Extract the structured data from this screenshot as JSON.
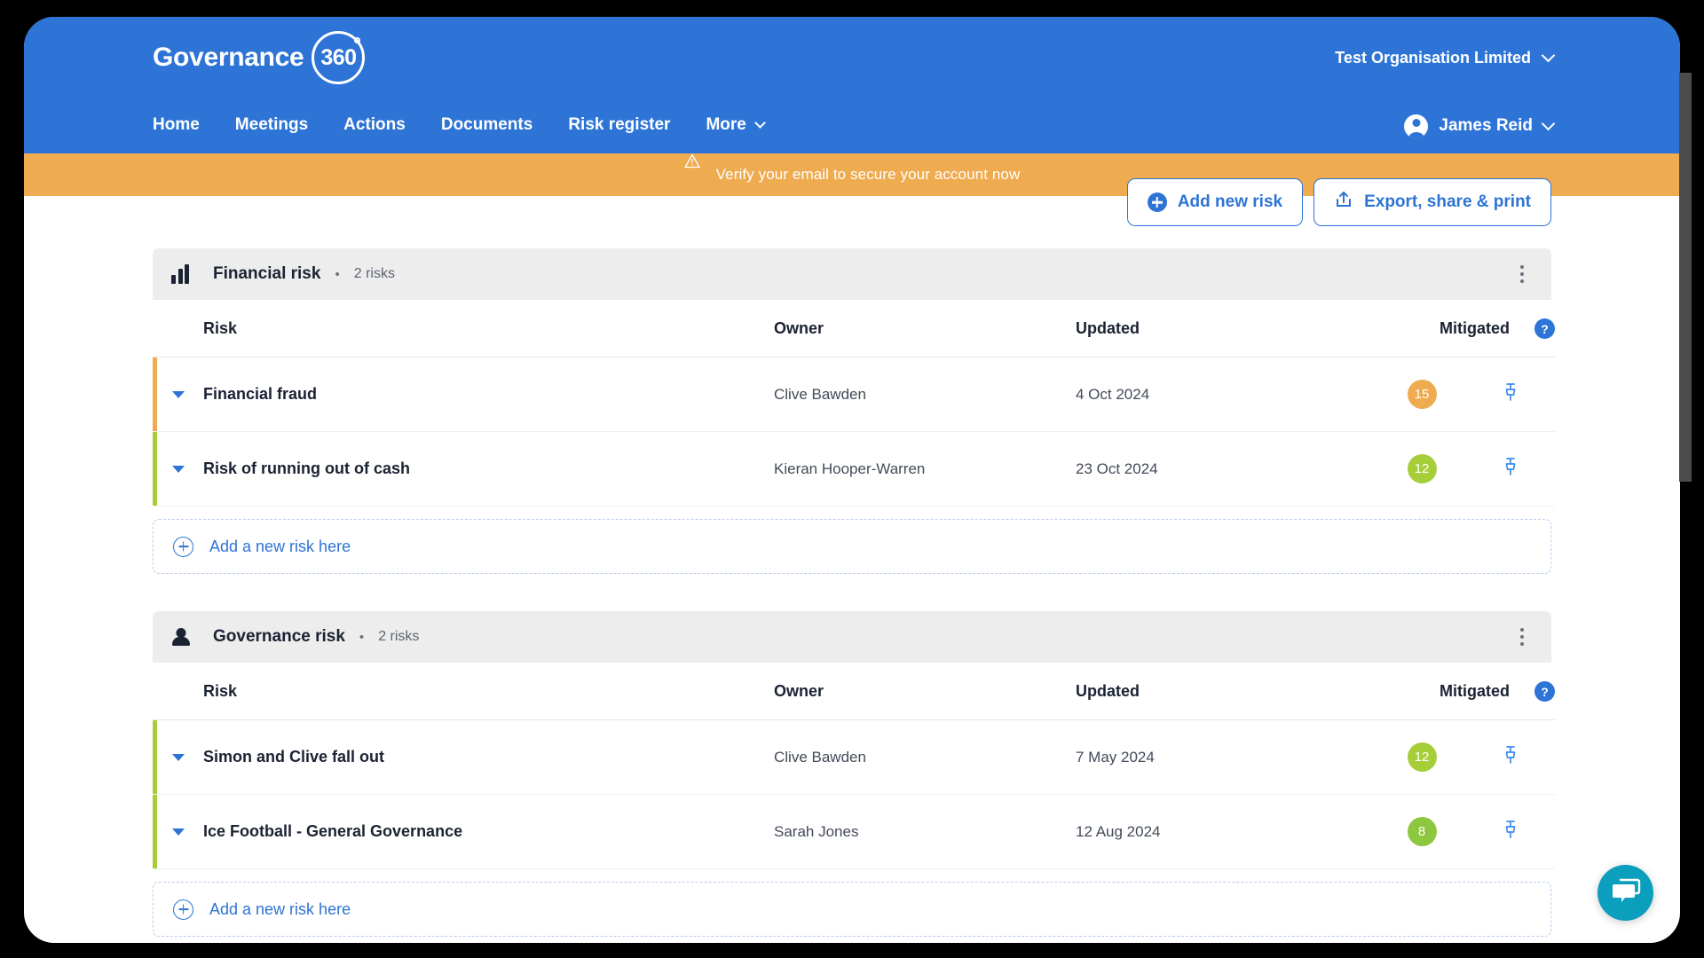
{
  "header": {
    "logo_word": "Governance",
    "logo_badge": "360",
    "org_name": "Test Organisation Limited",
    "user_name": "James Reid",
    "nav": [
      {
        "label": "Home",
        "has_chevron": false
      },
      {
        "label": "Meetings",
        "has_chevron": false
      },
      {
        "label": "Actions",
        "has_chevron": false
      },
      {
        "label": "Documents",
        "has_chevron": false
      },
      {
        "label": "Risk register",
        "has_chevron": false
      },
      {
        "label": "More",
        "has_chevron": true
      }
    ]
  },
  "banner": {
    "message": "Verify your email to secure your account now",
    "bg_color": "#eeab4f"
  },
  "toolbar": {
    "add_new_risk_label": "Add new risk",
    "export_label": "Export, share & print",
    "accent_color": "#2d74d6"
  },
  "table_headers": {
    "risk": "Risk",
    "owner": "Owner",
    "updated": "Updated",
    "mitigated": "Mitigated",
    "help": "?"
  },
  "add_new_row_label": "Add a new risk here",
  "groups": [
    {
      "title": "Financial risk",
      "separator": "•",
      "count_label": "2 risks",
      "icon": "bar-chart-icon",
      "rows": [
        {
          "risk": "Financial fraud",
          "owner": "Clive Bawden",
          "updated": "4 Oct 2024",
          "mitigated": "15",
          "badge_color": "#eeab4f",
          "severity_color": "#eeab4f"
        },
        {
          "risk": "Risk of running out of cash",
          "owner": "Kieran Hooper-Warren",
          "updated": "23 Oct 2024",
          "mitigated": "12",
          "badge_color": "#a6ce39",
          "severity_color": "#a6ce39"
        }
      ]
    },
    {
      "title": "Governance risk",
      "separator": "•",
      "count_label": "2 risks",
      "icon": "person-icon",
      "rows": [
        {
          "risk": "Simon and Clive fall out",
          "owner": "Clive Bawden",
          "updated": "7 May 2024",
          "mitigated": "12",
          "badge_color": "#a6ce39",
          "severity_color": "#a6ce39"
        },
        {
          "risk": "Ice Football - General Governance",
          "owner": "Sarah Jones",
          "updated": "12 Aug 2024",
          "mitigated": "8",
          "badge_color": "#8dc63f",
          "severity_color": "#a6ce39"
        }
      ]
    }
  ],
  "chat_widget": {
    "icon": "chat-bubble-icon",
    "color": "#0c9ebd"
  }
}
